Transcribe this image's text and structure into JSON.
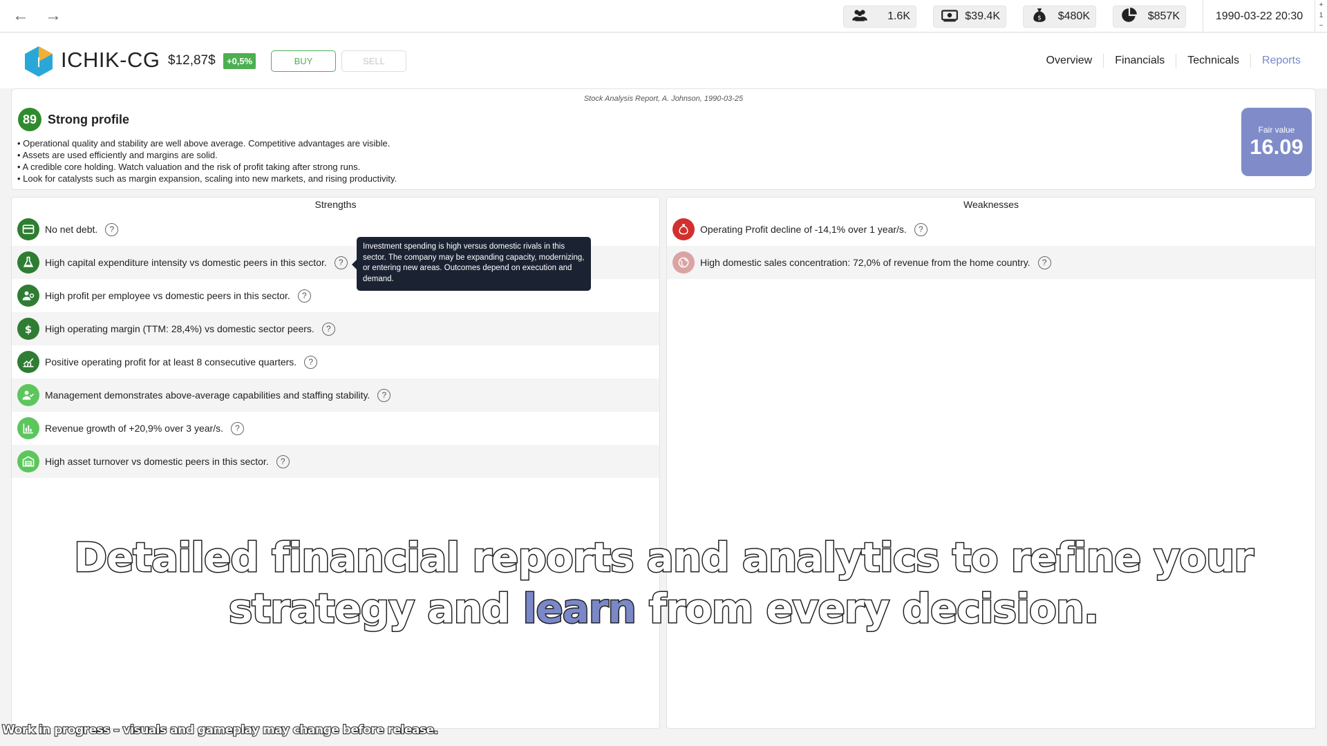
{
  "topbar": {
    "back_icon": "arrow-left-icon",
    "forward_icon": "arrow-right-icon",
    "stats": [
      {
        "icon": "people-icon",
        "value": "1.6K"
      },
      {
        "icon": "cash-icon",
        "value": "$39.4K"
      },
      {
        "icon": "money-bag-icon",
        "value": "$480K"
      },
      {
        "icon": "pie-chart-icon",
        "value": "$857K"
      }
    ],
    "datetime": "1990-03-22 20:30",
    "speed": {
      "plus": "+",
      "value": "1",
      "minus": "−"
    }
  },
  "header": {
    "logo_letter": "I",
    "ticker": "ICHIK-CG",
    "price": "$12,87$",
    "change": "+0,5%",
    "buy_label": "BUY",
    "sell_label": "SELL",
    "tabs": [
      "Overview",
      "Financials",
      "Technicals",
      "Reports"
    ],
    "active_tab": "Reports"
  },
  "summary": {
    "report_meta": "Stock Analysis Report, A. Johnson, 1990-03-25",
    "score": "89",
    "profile_title": "Strong profile",
    "bullets": [
      "Operational quality and stability are well above average. Competitive advantages are visible.",
      "Assets are used efficiently and margins are solid.",
      "A credible core holding. Watch valuation and the risk of profit taking after strong runs.",
      "Look for catalysts such as margin expansion, scaling into new markets, and rising productivity."
    ],
    "fair_value_label": "Fair value",
    "fair_value": "16.09"
  },
  "strengths": {
    "title": "Strengths",
    "items": [
      {
        "text": "No net debt.",
        "icon": "credit-card-icon",
        "color": "#2e7d32"
      },
      {
        "text": "High capital expenditure intensity vs domestic peers in this sector.",
        "icon": "flask-icon",
        "color": "#2e7d32"
      },
      {
        "text": "High profit per employee vs domestic peers in this sector.",
        "icon": "person-gear-icon",
        "color": "#2e7d32"
      },
      {
        "text": "High operating margin (TTM: 28,4%) vs domestic sector peers.",
        "icon": "dollar-icon",
        "color": "#2e7d32"
      },
      {
        "text": "Positive operating profit for at least 8 consecutive quarters.",
        "icon": "trend-chart-icon",
        "color": "#2e7d32"
      },
      {
        "text": "Management demonstrates above-average capabilities and staffing stability.",
        "icon": "person-check-icon",
        "color": "#5cc65c"
      },
      {
        "text": "Revenue growth of +20,9% over 3 year/s.",
        "icon": "bar-chart-icon",
        "color": "#5cc65c"
      },
      {
        "text": "High asset turnover vs domestic peers in this sector.",
        "icon": "warehouse-icon",
        "color": "#5cc65c"
      }
    ]
  },
  "weaknesses": {
    "title": "Weaknesses",
    "items": [
      {
        "text": "Operating Profit decline of -14,1% over 1 year/s.",
        "icon": "money-bag-icon",
        "color": "#d32f2f"
      },
      {
        "text": "High domestic sales concentration: 72,0% of revenue from the home country.",
        "icon": "globe-icon",
        "color": "#dca3a3"
      }
    ]
  },
  "tooltip": {
    "text": "Investment spending is high versus domestic rivals in this sector. The company may be expanding capacity, modernizing, or entering new areas. Outcomes depend on execution and demand."
  },
  "caption": {
    "line1": "Detailed financial reports and analytics to refine your",
    "line2_before": "strategy and ",
    "line2_highlight": "learn",
    "line2_after": " from every decision."
  },
  "wip_notice": "Work in progress – visuals and gameplay may change before release.",
  "colors": {
    "accent": "#7f8cc9",
    "positive": "#4caf50",
    "negative": "#d32f2f"
  }
}
